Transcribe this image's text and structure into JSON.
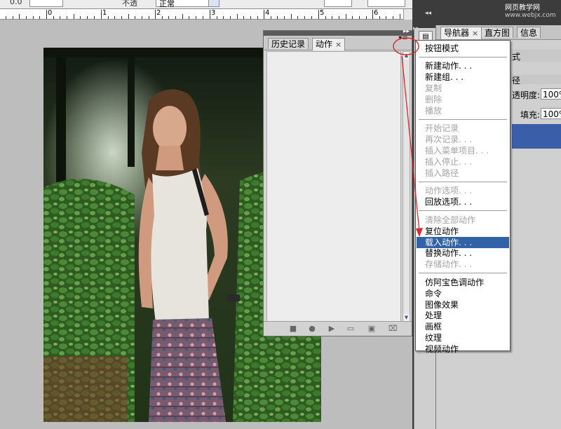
{
  "options_bar": {
    "left_value": "0.0",
    "field_value": "正常",
    "label": "不透"
  },
  "ruler": {
    "numbers": [
      "0",
      "1",
      "2",
      "3",
      "4",
      "5",
      "6"
    ]
  },
  "actions_panel": {
    "tabs": [
      {
        "label": "历史记录",
        "active": false
      },
      {
        "label": "动作",
        "active": true,
        "close": "×"
      }
    ],
    "menu_button": "▾≡",
    "footer_buttons": [
      "stop-icon",
      "record-icon",
      "play-icon",
      "new-set-icon",
      "new-action-icon",
      "trash-icon"
    ]
  },
  "dock": {
    "tabs": [
      {
        "label": "导航器",
        "close": "×"
      },
      {
        "label": "直方图"
      },
      {
        "label": "信息"
      }
    ],
    "row1_text": "式",
    "row2_text": "径",
    "opacity_label": "透明度:",
    "opacity_value": "100%",
    "fill_label": "填充:",
    "fill_value": "100%"
  },
  "watermark": {
    "title": "网页教学网",
    "url": "www.webjx.com"
  },
  "flyout_menu": {
    "groups": [
      [
        {
          "label": "按钮模式",
          "state": "enabled"
        }
      ],
      [
        {
          "label": "新建动作. . .",
          "state": "enabled"
        },
        {
          "label": "新建组. . .",
          "state": "enabled"
        },
        {
          "label": "复制",
          "state": "disabled"
        },
        {
          "label": "删除",
          "state": "disabled"
        },
        {
          "label": "播放",
          "state": "disabled"
        }
      ],
      [
        {
          "label": "开始记录",
          "state": "disabled"
        },
        {
          "label": "再次记录. . .",
          "state": "disabled"
        },
        {
          "label": "插入菜单项目. . .",
          "state": "disabled"
        },
        {
          "label": "插入停止. . .",
          "state": "disabled"
        },
        {
          "label": "插入路径",
          "state": "disabled"
        }
      ],
      [
        {
          "label": "动作选项. . .",
          "state": "disabled"
        },
        {
          "label": "回放选项. . .",
          "state": "enabled"
        }
      ],
      [
        {
          "label": "清除全部动作",
          "state": "disabled"
        },
        {
          "label": "复位动作",
          "state": "enabled"
        },
        {
          "label": "载入动作. . .",
          "state": "selected"
        },
        {
          "label": "替换动作. . .",
          "state": "enabled"
        },
        {
          "label": "存储动作. . .",
          "state": "disabled"
        }
      ],
      [
        {
          "label": "仿阿宝色调动作",
          "state": "enabled"
        },
        {
          "label": "命令",
          "state": "enabled"
        },
        {
          "label": "图像效果",
          "state": "enabled"
        },
        {
          "label": "处理",
          "state": "enabled"
        },
        {
          "label": "画框",
          "state": "enabled"
        },
        {
          "label": "纹理",
          "state": "enabled"
        },
        {
          "label": "视频动作",
          "state": "enabled"
        }
      ]
    ]
  },
  "colors": {
    "selection": "#3161a6",
    "annotation_red": "#e0262a",
    "disabled_text": "#a3a3a3"
  }
}
